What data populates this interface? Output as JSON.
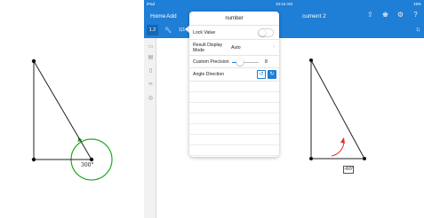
{
  "status_bar": {
    "carrier": "iPad",
    "time": "10:44 AM",
    "battery": "19%"
  },
  "nav": {
    "home_label": "Home",
    "add_label": "Add",
    "document_title": "cument 2",
    "icons": [
      "share-icon",
      "user-icon",
      "gear-icon",
      "help-icon"
    ]
  },
  "toolbar": {
    "number_label": "1.2",
    "measure_label": "1|1",
    "right_label": "1|"
  },
  "popover": {
    "title": "number",
    "lock_value_label": "Lock Value",
    "lock_value_on": false,
    "result_display_label": "Result Display Mode",
    "result_display_value": "Auto",
    "custom_precision_label": "Custom Precision",
    "custom_precision_value": "8",
    "angle_direction_label": "Angle Direction",
    "accent_color": "#1f7ed6"
  },
  "left_figure": {
    "angle_label": "300°",
    "arc_color": "#22aa22"
  },
  "right_figure": {
    "angle_label": "-60°",
    "arc_color": "#e0322a"
  }
}
